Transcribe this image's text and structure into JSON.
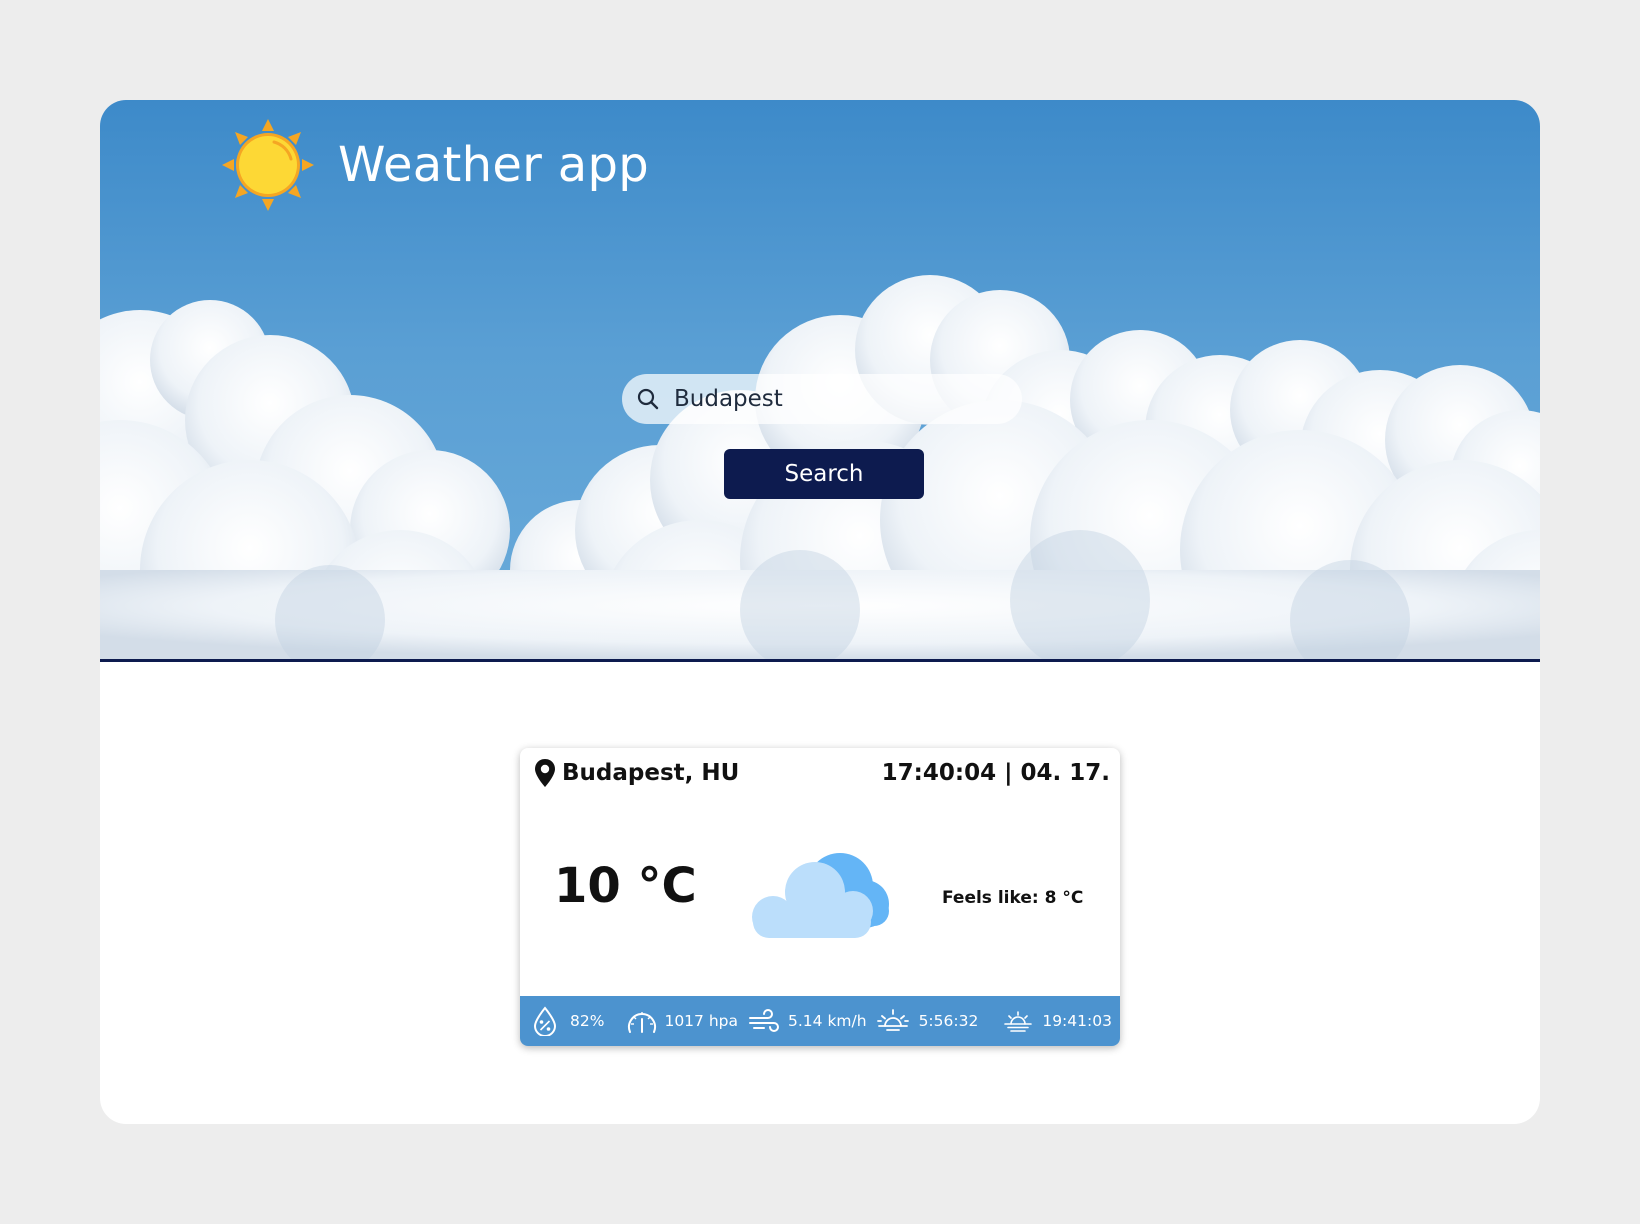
{
  "app": {
    "title": "Weather app",
    "logo_icon": "sun-icon"
  },
  "search": {
    "value": "Budapest",
    "placeholder": "",
    "button_label": "Search",
    "icon": "search-icon"
  },
  "weather": {
    "location": "Budapest, HU",
    "datetime": "17:40:04 | 04. 17.",
    "temperature": "10 °C",
    "condition_icon": "cloud-icon",
    "feels_like": "Feels like: 8 °C",
    "stats": {
      "humidity": "82%",
      "pressure": "1017 hpa",
      "wind": "5.14 km/h",
      "sunrise": "5:56:32",
      "sunset": "19:41:03"
    }
  },
  "colors": {
    "accent_dark": "#0d1b4f",
    "sky": "#4c93cf",
    "sun": "#fdd835",
    "sun_rays": "#f5a623"
  }
}
